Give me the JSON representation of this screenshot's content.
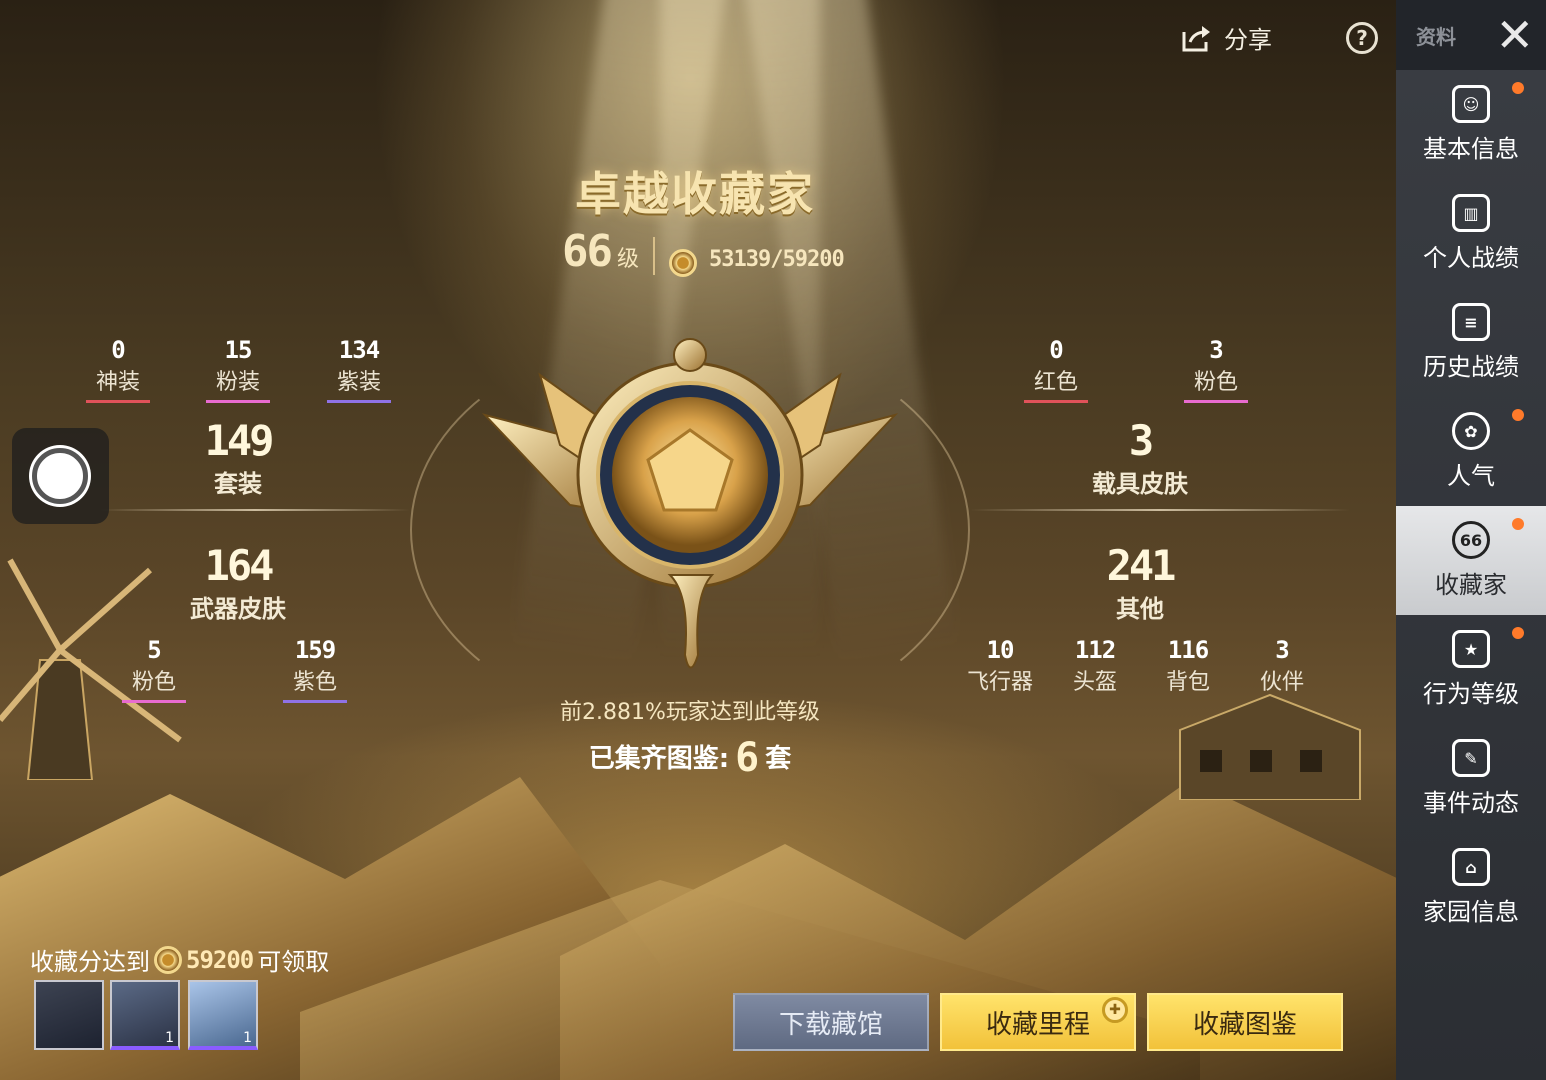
{
  "topbar": {
    "share_label": "分享"
  },
  "sidebar": {
    "header_label": "资料",
    "items": [
      {
        "label": "基本信息",
        "badge": true
      },
      {
        "label": "个人战绩",
        "badge": false
      },
      {
        "label": "历史战绩",
        "badge": false
      },
      {
        "label": "人气",
        "badge": true
      },
      {
        "label": "收藏家",
        "badge": true,
        "active": true,
        "icon_text": "66"
      },
      {
        "label": "行为等级",
        "badge": true
      },
      {
        "label": "事件动态",
        "badge": false
      },
      {
        "label": "家园信息",
        "badge": false
      }
    ]
  },
  "header": {
    "title": "卓越收藏家",
    "level": "66",
    "level_unit": "级",
    "score": "53139/59200"
  },
  "left_stats": {
    "top": [
      {
        "value": "0",
        "label": "神装",
        "color": "#e0525a"
      },
      {
        "value": "15",
        "label": "粉装",
        "color": "#e86bd0"
      },
      {
        "value": "134",
        "label": "紫装",
        "color": "#8f72e6"
      }
    ],
    "suits": {
      "value": "149",
      "label": "套装"
    },
    "weapons": {
      "value": "164",
      "label": "武器皮肤"
    },
    "bottom": [
      {
        "value": "5",
        "label": "粉色",
        "color": "#e86bd0"
      },
      {
        "value": "159",
        "label": "紫色",
        "color": "#8f72e6"
      }
    ]
  },
  "right_stats": {
    "top": [
      {
        "value": "0",
        "label": "红色",
        "color": "#e0525a"
      },
      {
        "value": "3",
        "label": "粉色",
        "color": "#e86bd0"
      }
    ],
    "vehicles": {
      "value": "3",
      "label": "载具皮肤"
    },
    "others": {
      "value": "241",
      "label": "其他"
    },
    "bottom": [
      {
        "value": "10",
        "label": "飞行器"
      },
      {
        "value": "112",
        "label": "头盔"
      },
      {
        "value": "116",
        "label": "背包"
      },
      {
        "value": "3",
        "label": "伙伴"
      }
    ]
  },
  "rank_text": "前2.881%玩家达到此等级",
  "completed": {
    "prefix": "已集齐图鉴:",
    "count": "6",
    "suffix": "套"
  },
  "reward": {
    "prefix": "收藏分达到",
    "value": "59200",
    "suffix": "可领取",
    "items": [
      "",
      "1",
      "1"
    ]
  },
  "buttons": {
    "download": "下载藏馆",
    "milestone": "收藏里程",
    "catalog": "收藏图鉴"
  }
}
